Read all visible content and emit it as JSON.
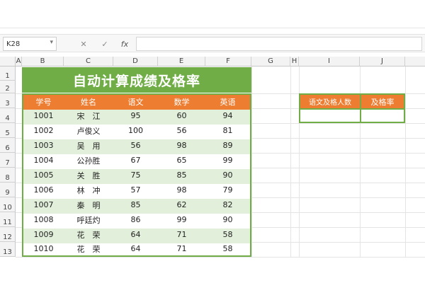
{
  "formula_bar": {
    "name_box": "K28",
    "cancel_icon": "✕",
    "confirm_icon": "✓",
    "fx_label": "fx",
    "formula": ""
  },
  "columns": [
    "A",
    "B",
    "C",
    "D",
    "E",
    "F",
    "G",
    "H",
    "I",
    "J"
  ],
  "rows": [
    "1",
    "2",
    "3",
    "4",
    "5",
    "6",
    "7",
    "8",
    "9",
    "10",
    "11",
    "12",
    "13"
  ],
  "title": "自动计算成绩及格率",
  "table": {
    "headers": [
      "学号",
      "姓名",
      "语文",
      "数学",
      "英语"
    ],
    "rows": [
      [
        "1001",
        "宋　江",
        "95",
        "60",
        "94"
      ],
      [
        "1002",
        "卢俊义",
        "100",
        "56",
        "81"
      ],
      [
        "1003",
        "吴　用",
        "56",
        "98",
        "89"
      ],
      [
        "1004",
        "公孙胜",
        "67",
        "65",
        "99"
      ],
      [
        "1005",
        "关　胜",
        "75",
        "85",
        "90"
      ],
      [
        "1006",
        "林　冲",
        "57",
        "98",
        "79"
      ],
      [
        "1007",
        "秦　明",
        "85",
        "62",
        "82"
      ],
      [
        "1008",
        "呼廷灼",
        "86",
        "99",
        "90"
      ],
      [
        "1009",
        "花　荣",
        "64",
        "71",
        "58"
      ],
      [
        "1010",
        "花　荣",
        "64",
        "71",
        "58"
      ]
    ]
  },
  "side_table": {
    "headers": [
      "语文及格人数",
      "及格率"
    ],
    "values": [
      "",
      ""
    ]
  },
  "colors": {
    "title_bg": "#70ad47",
    "header_bg": "#ed7d31",
    "row_alt_bg": "#e2efda",
    "border_green": "#70ad47"
  }
}
